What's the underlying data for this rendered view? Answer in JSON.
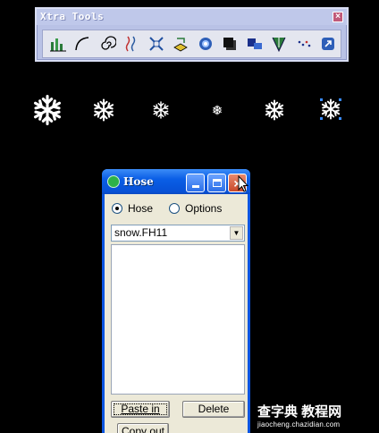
{
  "xtra_tools": {
    "title": "Xtra Tools",
    "close_icon": "close-icon",
    "tools": [
      {
        "name": "chart-tool-icon"
      },
      {
        "name": "arc-tool-icon"
      },
      {
        "name": "spiral-tool-icon"
      },
      {
        "name": "graphic-hose-icon"
      },
      {
        "name": "fisheye-tool-icon"
      },
      {
        "name": "3d-rotation-icon"
      },
      {
        "name": "smudge-tool-icon"
      },
      {
        "name": "shadow-tool-icon"
      },
      {
        "name": "trace-tool-icon"
      },
      {
        "name": "roughen-tool-icon"
      },
      {
        "name": "bend-tool-icon"
      },
      {
        "name": "redraw-path-icon"
      }
    ],
    "colors": {
      "frame": "#b9c2e6",
      "title_text": "#ffffff"
    }
  },
  "snowflakes": [
    {
      "name": "snowflake-large"
    },
    {
      "name": "snowflake-medium"
    },
    {
      "name": "snowflake-small"
    },
    {
      "name": "snowflake-tiny"
    },
    {
      "name": "snowflake-medium-2"
    },
    {
      "name": "snowflake-selected"
    }
  ],
  "hose": {
    "title": "Hose",
    "radio_hose": "Hose",
    "radio_options": "Options",
    "selected_radio": "Hose",
    "select_value": "snow.FH11",
    "buttons": {
      "paste_in": "Paste in",
      "delete": "Delete",
      "copy_out": "Copy out"
    },
    "colors": {
      "titlebar": "#0a5ee6",
      "panel": "#ece9d8"
    }
  },
  "watermark": {
    "text": "查字典 教程网",
    "url": "jiaocheng.chazidian.com"
  }
}
